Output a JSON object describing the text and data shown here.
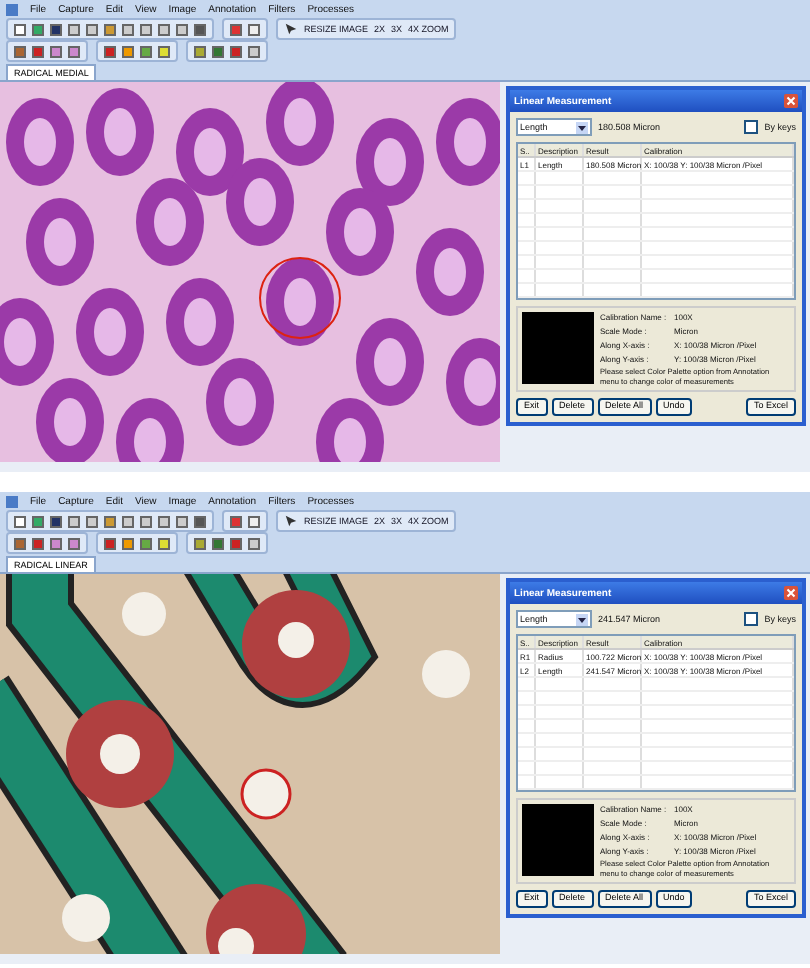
{
  "screens": [
    {
      "menu": [
        "File",
        "Capture",
        "Edit",
        "View",
        "Image",
        "Annotation",
        "Filters",
        "Processes"
      ],
      "tools": [
        "RESIZE IMAGE",
        "2X",
        "3X",
        "4X ZOOM"
      ],
      "tab": "RADICAL MEDIAL",
      "image": {
        "kind": "tissue"
      },
      "dialog": {
        "title": "Linear Measurement",
        "measure_type": "Length",
        "reading": "180.508 Micron",
        "by_keys": {
          "label": "By keys",
          "checked": false
        },
        "columns": [
          "S..",
          "Description",
          "Result",
          "Calibration"
        ],
        "rows": [
          [
            "L1",
            "Length",
            "180.508 Micron",
            "X: 100/38 Y: 100/38 Micron /Pixel"
          ]
        ],
        "info": [
          {
            "label": "Calibration Name :",
            "value": "100X"
          },
          {
            "label": "Scale Mode :",
            "value": "Micron"
          },
          {
            "label": "Along X-axis :",
            "value": "X: 100/38 Micron /Pixel"
          },
          {
            "label": "Along Y-axis :",
            "value": "Y: 100/38 Micron /Pixel"
          }
        ],
        "note": "Please select Color Palette option from Annotation menu to change color of measurements",
        "buttons": [
          "Exit",
          "Delete",
          "Delete All",
          "Undo"
        ],
        "export_button": "To Excel"
      }
    },
    {
      "menu": [
        "File",
        "Capture",
        "Edit",
        "View",
        "Image",
        "Annotation",
        "Filters",
        "Processes"
      ],
      "tools": [
        "RESIZE IMAGE",
        "2X",
        "3X",
        "4X ZOOM"
      ],
      "tab": "RADICAL LINEAR",
      "image": {
        "kind": "circuit"
      },
      "dialog": {
        "title": "Linear Measurement",
        "measure_type": "Length",
        "reading": "241.547 Micron",
        "by_keys": {
          "label": "By keys",
          "checked": false
        },
        "columns": [
          "S..",
          "Description",
          "Result",
          "Calibration"
        ],
        "rows": [
          [
            "R1",
            "Radius",
            "100.722 Micron",
            "X: 100/38 Y: 100/38 Micron /Pixel"
          ],
          [
            "L2",
            "Length",
            "241.547 Micron",
            "X: 100/38 Y: 100/38 Micron /Pixel"
          ]
        ],
        "info": [
          {
            "label": "Calibration Name :",
            "value": "100X"
          },
          {
            "label": "Scale Mode :",
            "value": "Micron"
          },
          {
            "label": "Along X-axis :",
            "value": "X: 100/38 Micron /Pixel"
          },
          {
            "label": "Along Y-axis :",
            "value": "Y: 100/38 Micron /Pixel"
          }
        ],
        "note": "Please select Color Palette option from Annotation menu to change color of measurements",
        "buttons": [
          "Exit",
          "Delete",
          "Delete All",
          "Undo"
        ],
        "export_button": "To Excel"
      }
    }
  ]
}
